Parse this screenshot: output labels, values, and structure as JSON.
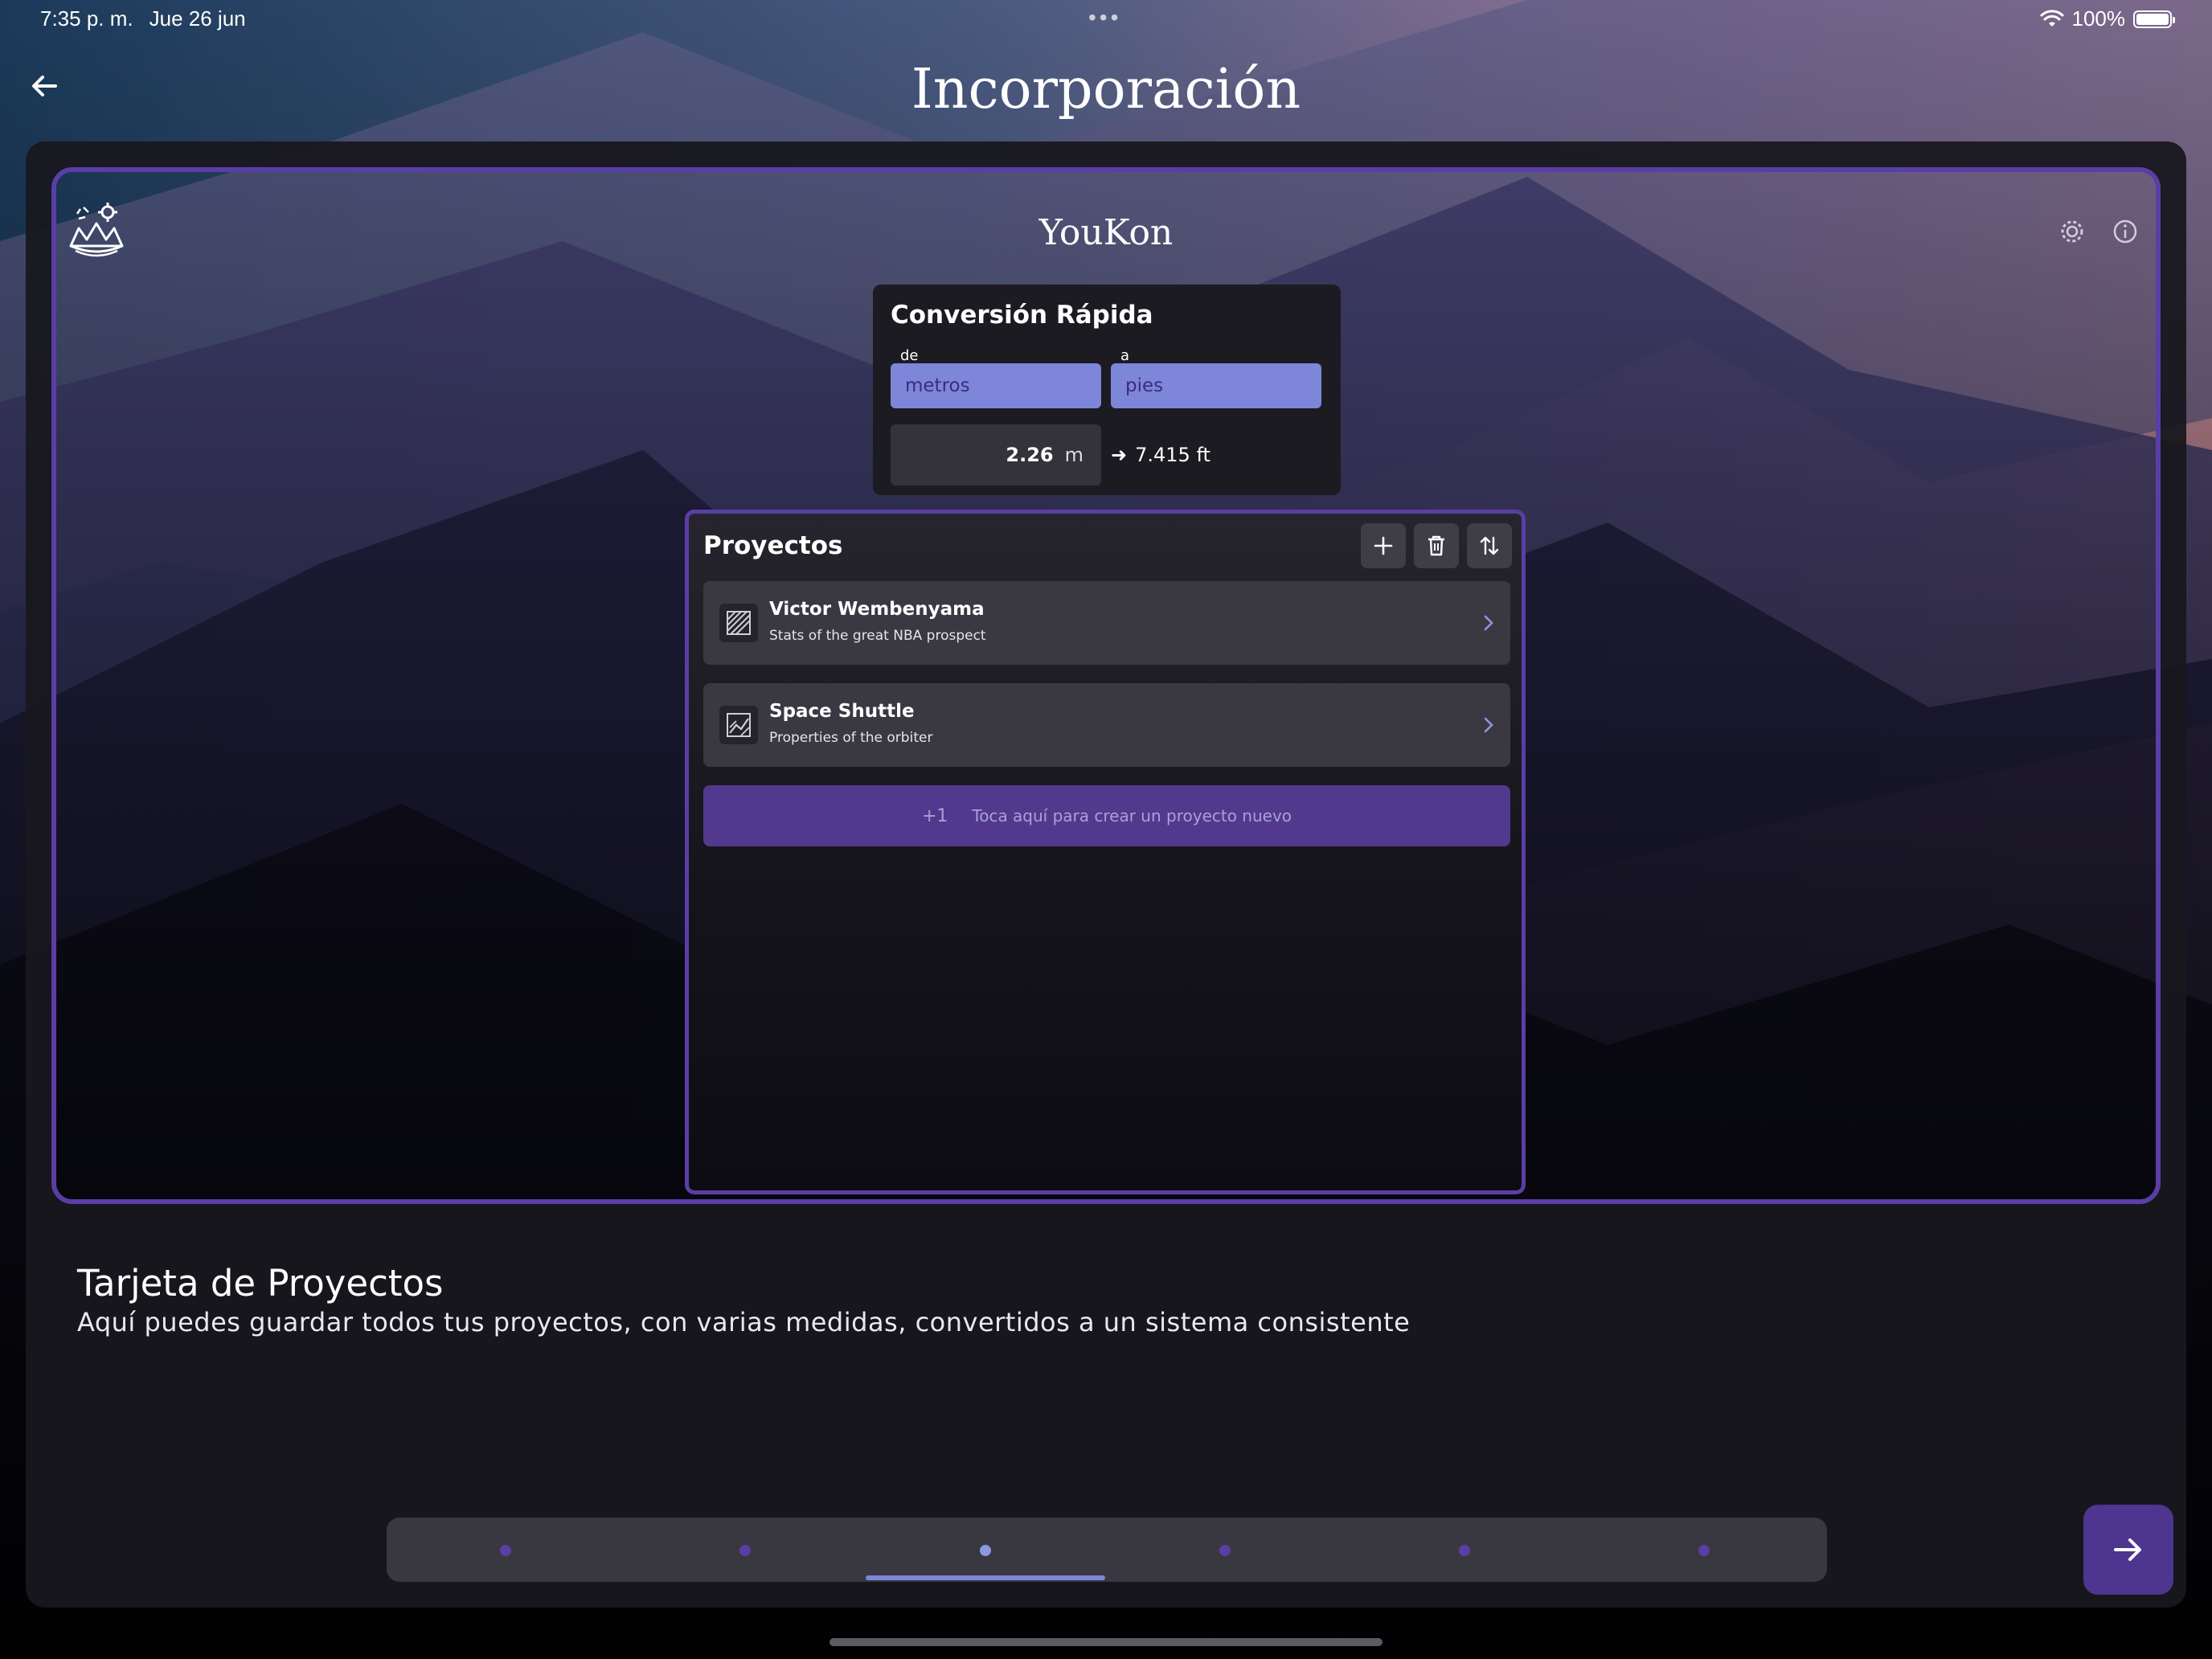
{
  "status_bar": {
    "time": "7:35 p. m.",
    "date": "Jue 26 jun",
    "multitask_dots": "•••",
    "battery_percent": "100%"
  },
  "header": {
    "title": "Incorporación",
    "back_icon": "arrow-left-icon"
  },
  "app_preview": {
    "app_title": "YouKon",
    "logo_icon": "mountain-crown-gear-icon",
    "settings_icon": "gear-icon",
    "info_icon": "info-icon",
    "quick_conversion": {
      "title": "Conversión Rápida",
      "from_label": "de",
      "to_label": "a",
      "from_unit": "metros",
      "to_unit": "pies",
      "input_value": "2.26",
      "input_unit": "m",
      "result_arrow": "➜",
      "result": "7.415 ft"
    },
    "projects": {
      "title": "Proyectos",
      "add_icon": "plus-icon",
      "delete_icon": "trash-icon",
      "sort_icon": "sort-arrows-icon",
      "items": [
        {
          "name": "Victor Wembenyama",
          "description": "Stats of the great NBA prospect",
          "icon": "project-pattern-icon"
        },
        {
          "name": "Space Shuttle",
          "description": "Properties of the orbiter",
          "icon": "project-chart-icon"
        }
      ],
      "new_project_prefix": "+1",
      "new_project_label": "Toca aquí para crear un proyecto nuevo"
    }
  },
  "description": {
    "title": "Tarjeta de Proyectos",
    "body": "Aquí puedes guardar todos tus proyectos, con varias medidas, convertidos a un sistema consistente"
  },
  "pager": {
    "page_count": 6,
    "active_index": 2
  },
  "next_icon": "arrow-right-icon",
  "colors": {
    "accent": "#5a3ea6",
    "selector": "#7d86d8",
    "button_fill": "#4d3590",
    "card": "#1c1b22"
  }
}
